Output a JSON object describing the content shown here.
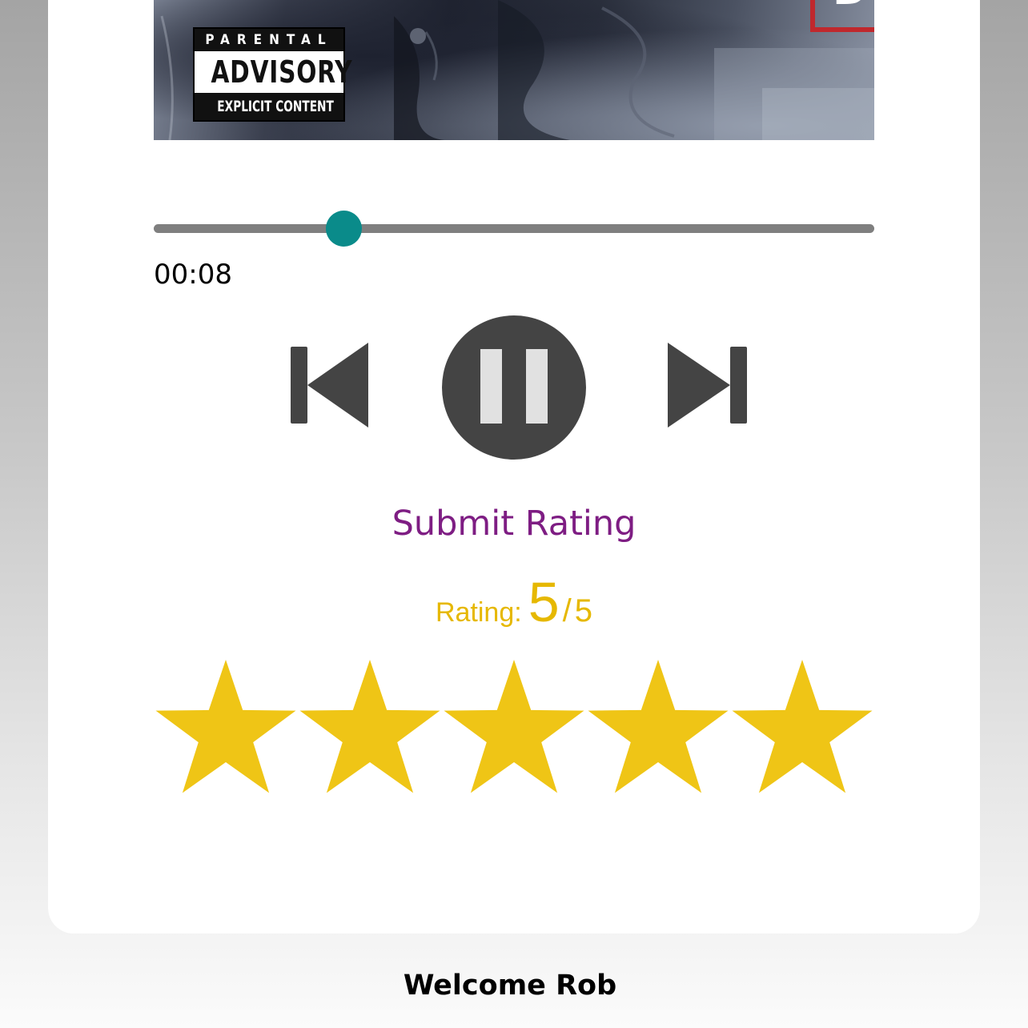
{
  "album": {
    "advisory_top": "PARENTAL",
    "advisory_middle": "ADVISORY",
    "advisory_bottom": "EXPLICIT CONTENT",
    "frame_text": "DENT"
  },
  "player": {
    "elapsed": "00:08",
    "progress_fraction": 0.264,
    "accent_color": "#0a8b8a",
    "controls": {
      "previous_icon": "skip-previous-icon",
      "pause_icon": "pause-icon",
      "next_icon": "skip-next-icon"
    }
  },
  "rating": {
    "submit_label": "Submit Rating",
    "label": "Rating:",
    "value": "5",
    "separator": "/",
    "max": "5",
    "stars_filled": 5,
    "star_color": "#efc516",
    "text_color": "#e6b800"
  },
  "footer": {
    "welcome": "Welcome Rob"
  },
  "colors": {
    "submit": "#7e1d83",
    "controls": "#444444"
  }
}
